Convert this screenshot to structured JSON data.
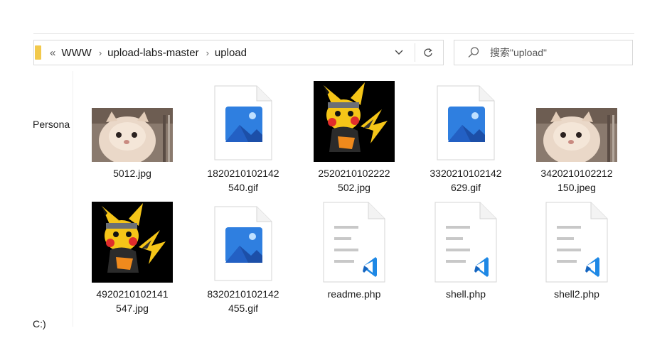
{
  "address": {
    "back": "«",
    "crumbs": [
      "WWW",
      "upload-labs-master",
      "upload"
    ],
    "separator": "›",
    "dropdown_icon": "chevron-down-icon",
    "refresh_icon": "refresh-icon"
  },
  "search": {
    "placeholder": "搜索\"upload\"",
    "icon": "search-icon"
  },
  "nav": {
    "personal": "Persona",
    "drive": "C:)"
  },
  "files": [
    {
      "name": "5012.jpg",
      "type": "cat"
    },
    {
      "name": "1820210102142\n540.gif",
      "type": "image-icon"
    },
    {
      "name": "2520210102222\n502.jpg",
      "type": "pikachu"
    },
    {
      "name": "3320210102142\n629.gif",
      "type": "image-icon"
    },
    {
      "name": "3420210102212\n150.jpeg",
      "type": "cat"
    },
    {
      "name": "4920210102141\n547.jpg",
      "type": "pikachu"
    },
    {
      "name": "8320210102142\n455.gif",
      "type": "image-icon"
    },
    {
      "name": "readme.php",
      "type": "vscode-file"
    },
    {
      "name": "shell.php",
      "type": "vscode-file"
    },
    {
      "name": "shell2.php",
      "type": "vscode-file"
    }
  ],
  "colors": {
    "accent": "#2f7fe0",
    "vscode_blue": "#1e88e5",
    "folder": "#f2c94c"
  }
}
